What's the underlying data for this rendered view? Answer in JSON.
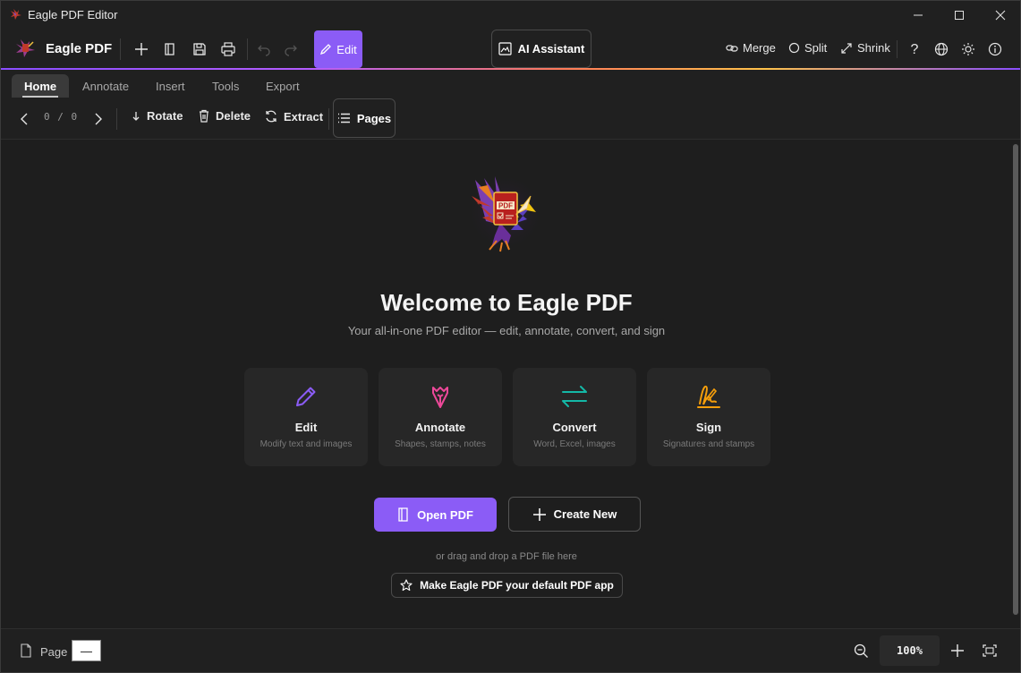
{
  "window": {
    "title": "Eagle PDF Editor"
  },
  "toolbar": {
    "brand": "Eagle PDF",
    "edit_label": "Edit",
    "ai_label": "AI Assistant",
    "merge_label": "Merge",
    "split_label": "Split",
    "shrink_label": "Shrink"
  },
  "tabs": [
    {
      "label": "Home",
      "active": true
    },
    {
      "label": "Annotate"
    },
    {
      "label": "Insert"
    },
    {
      "label": "Tools"
    },
    {
      "label": "Export"
    }
  ],
  "ribbon": {
    "page_current": "0",
    "page_sep": "/",
    "page_total": "0",
    "rotate_label": "Rotate",
    "delete_label": "Delete",
    "extract_label": "Extract",
    "pages_label": "Pages"
  },
  "welcome": {
    "title": "Welcome to Eagle PDF",
    "subtitle": "Your all-in-one PDF editor — edit, annotate, convert, and sign",
    "cards": [
      {
        "title": "Edit",
        "desc": "Modify text and images",
        "icon": "pencil-icon",
        "color": "#8b5cf6"
      },
      {
        "title": "Annotate",
        "desc": "Shapes, stamps, notes",
        "icon": "pen-nib-icon",
        "color": "#ec4899"
      },
      {
        "title": "Convert",
        "desc": "Word, Excel, images",
        "icon": "arrows-exchange-icon",
        "color": "#14b8a6"
      },
      {
        "title": "Sign",
        "desc": "Signatures and stamps",
        "icon": "signature-icon",
        "color": "#f59e0b"
      }
    ],
    "open_label": "Open PDF",
    "create_label": "Create New",
    "drag_text": "or drag and drop a PDF file here",
    "default_label": "Make Eagle PDF your default PDF app",
    "logo_text": "PDF"
  },
  "status": {
    "page_label": "Page",
    "page_value": "—",
    "zoom": "100%"
  },
  "colors": {
    "accent": "#8b5cf6",
    "background": "#1e1e1e"
  }
}
